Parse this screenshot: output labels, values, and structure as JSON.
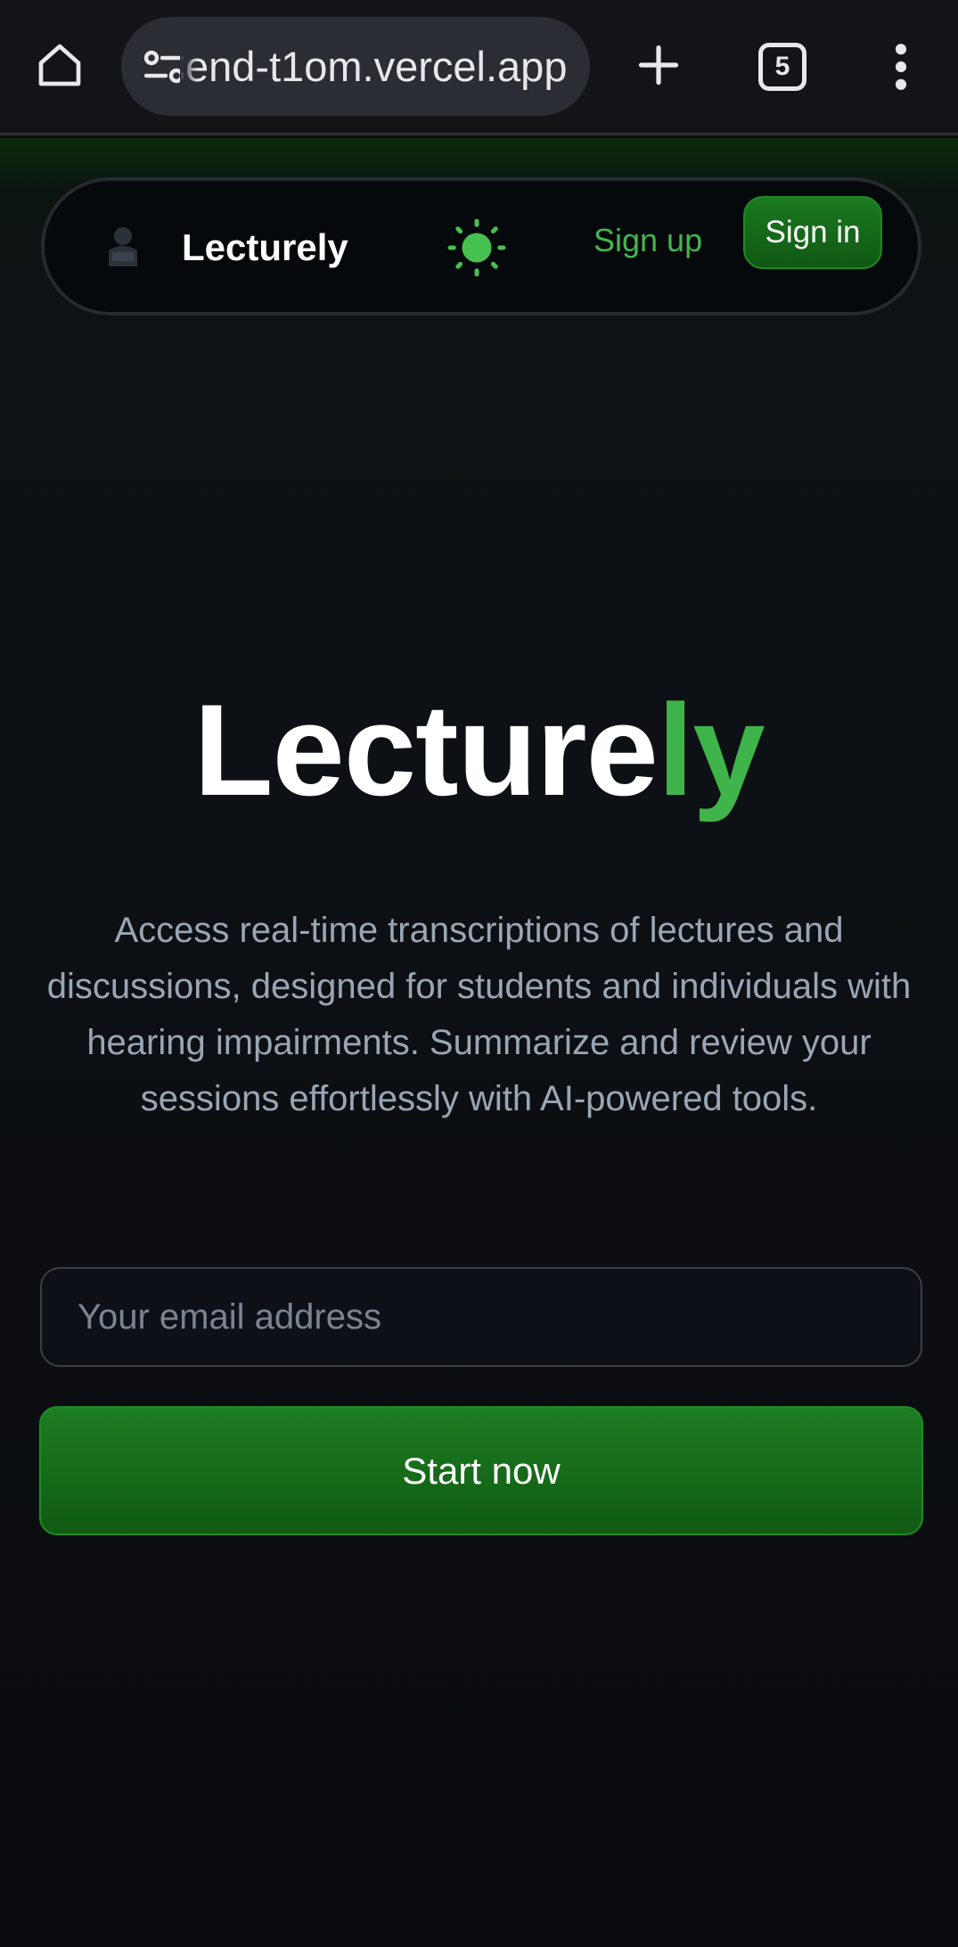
{
  "browser": {
    "url_text": "end-t1om.vercel.app",
    "tab_count": "5",
    "icons": [
      "home-icon",
      "site-settings-icon",
      "plus-icon",
      "tab-switcher-icon",
      "more-vert-icon"
    ]
  },
  "nav": {
    "brand": "Lecturely",
    "signup_label": "Sign up",
    "signin_label": "Sign in",
    "theme_icon": "sun-icon"
  },
  "hero": {
    "title_main": "Lecture",
    "title_accent": "ly",
    "description": "Access real-time transcriptions of lectures and discussions, designed for students and individuals with hearing impairments. Summarize and review your sessions effortlessly with AI-powered tools."
  },
  "form": {
    "email_placeholder": "Your email address",
    "start_label": "Start now"
  },
  "colors": {
    "accent": "#3fb44a",
    "button_green": "#1c7d20",
    "background": "#0b0e12",
    "text_muted": "#9aa6b4"
  }
}
